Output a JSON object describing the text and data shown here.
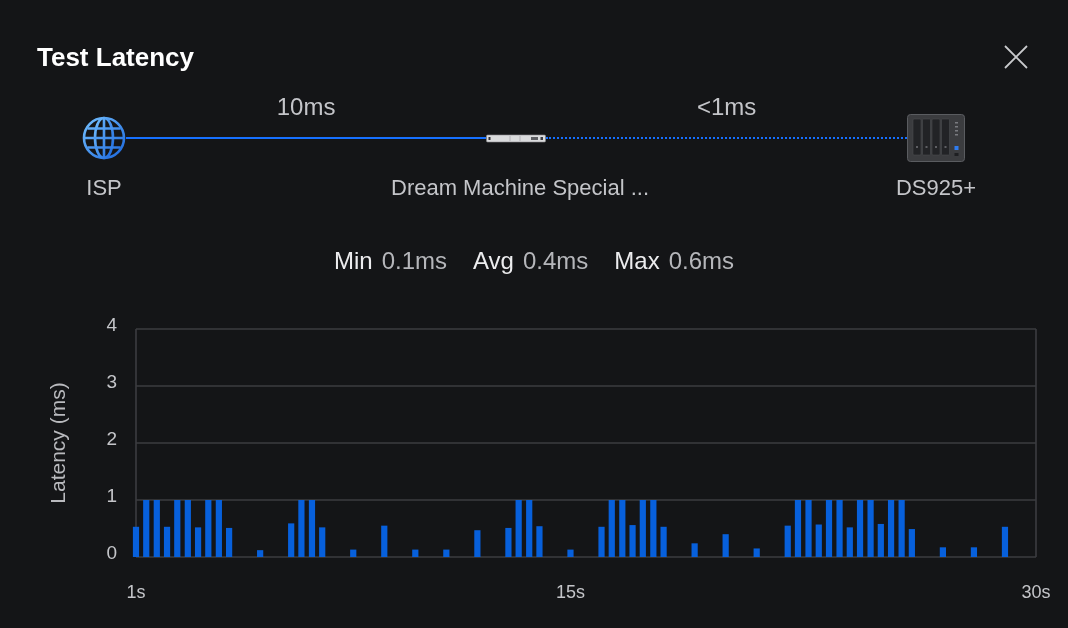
{
  "dialog": {
    "title": "Test Latency"
  },
  "topology": {
    "nodes": [
      {
        "kind": "globe",
        "name": "ISP"
      },
      {
        "kind": "router",
        "name": "Dream Machine Special ..."
      },
      {
        "kind": "nas",
        "name": "DS925+"
      }
    ],
    "links": [
      {
        "latency": "10ms",
        "dotted": false
      },
      {
        "latency": "<1ms",
        "dotted": true
      }
    ]
  },
  "stats": [
    {
      "label": "Min",
      "value": "0.1ms"
    },
    {
      "label": "Avg",
      "value": "0.4ms"
    },
    {
      "label": "Max",
      "value": "0.6ms"
    }
  ],
  "latency_chart": {
    "chart_data": {
      "type": "bar",
      "ylabel": "Latency (ms)",
      "x": [
        1,
        1.33,
        1.67,
        2,
        2.33,
        2.67,
        3,
        3.33,
        3.67,
        4,
        4.33,
        4.67,
        5,
        5.33,
        5.67,
        6,
        6.33,
        6.67,
        7,
        7.33,
        7.67,
        8,
        8.33,
        8.67,
        9,
        9.33,
        9.67,
        10,
        10.33,
        10.67,
        11,
        11.33,
        11.67,
        12,
        12.33,
        12.67,
        13,
        13.33,
        13.67,
        14,
        14.33,
        14.67,
        15,
        15.33,
        15.67,
        16,
        16.33,
        16.67,
        17,
        17.33,
        17.67,
        18,
        18.33,
        18.67,
        19,
        19.33,
        19.67,
        20,
        20.33,
        20.67,
        21,
        21.33,
        21.67,
        22,
        22.33,
        22.67,
        23,
        23.33,
        23.67,
        24,
        24.33,
        24.67,
        25,
        25.33,
        25.67,
        26,
        26.33,
        26.67,
        27,
        27.33,
        27.67,
        28,
        28.33,
        28.67,
        29,
        29.33,
        29.67
      ],
      "values": [
        0.53,
        1,
        1,
        0.53,
        1,
        1,
        0.52,
        1,
        1,
        0.51,
        0,
        0,
        0.12,
        0,
        0,
        0.59,
        1,
        1,
        0.52,
        0,
        0,
        0.13,
        0,
        0,
        0.55,
        0,
        0,
        0.13,
        0,
        0,
        0.13,
        0,
        0,
        0.47,
        0,
        0,
        0.51,
        1,
        1,
        0.54,
        0,
        0,
        0.13,
        0,
        0,
        0.53,
        1,
        1,
        0.56,
        1,
        1,
        0.53,
        0,
        0,
        0.24,
        0,
        0,
        0.4,
        0,
        0,
        0.15,
        0,
        0,
        0.55,
        1,
        1,
        0.57,
        1,
        1,
        0.52,
        1,
        1,
        0.58,
        1,
        1,
        0.49,
        0,
        0,
        0.17,
        0,
        0,
        0.17,
        0,
        0,
        0.53,
        0,
        0
      ],
      "xlim": [
        1,
        30
      ],
      "ylim": [
        0,
        4
      ],
      "xticks": [
        {
          "value": 1,
          "label": "1s"
        },
        {
          "value": 15,
          "label": "15s"
        },
        {
          "value": 30,
          "label": "30s"
        }
      ],
      "yticks": [
        0,
        1,
        2,
        3,
        4
      ],
      "grid": true
    }
  }
}
